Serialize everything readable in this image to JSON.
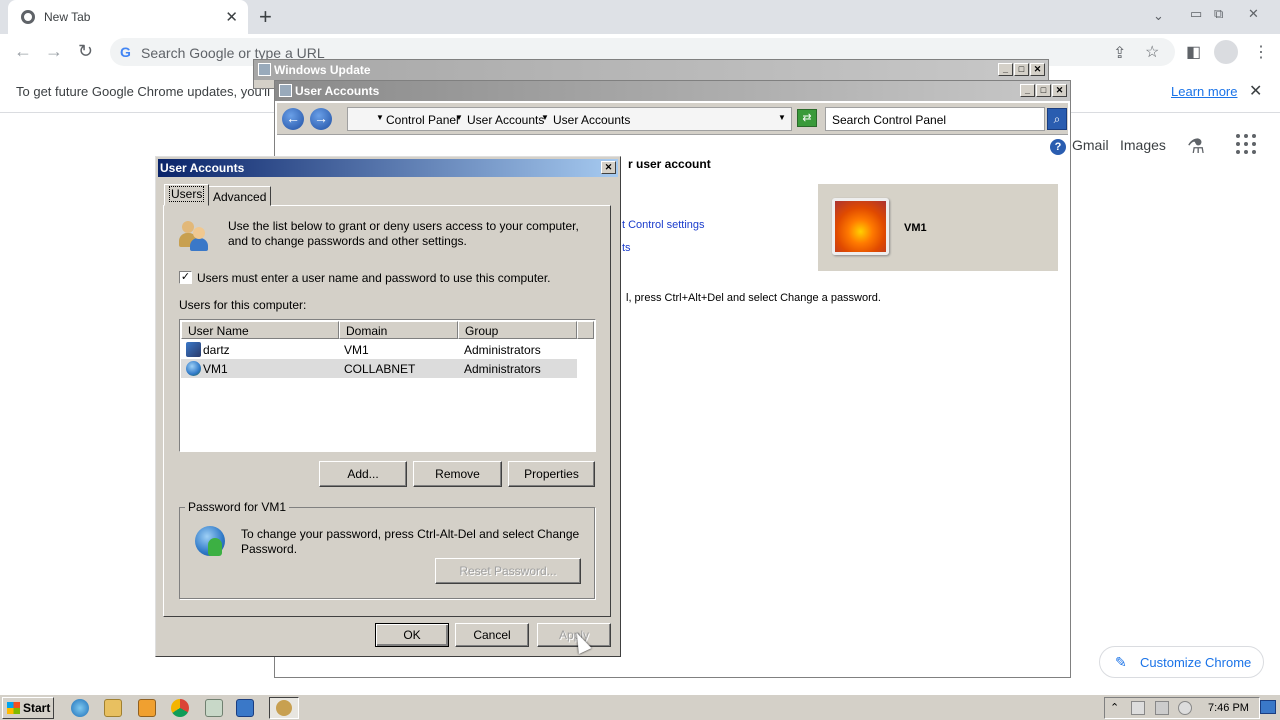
{
  "browser": {
    "tab_title": "New Tab",
    "omnibox_placeholder": "Search Google or type a URL",
    "infobar_text": "To get future Google Chrome updates, you'll",
    "learn_more": "Learn more",
    "ntp_links": [
      "Gmail",
      "Images"
    ],
    "customize_label": "Customize Chrome"
  },
  "windows_update": {
    "title": "Windows Update"
  },
  "user_accounts_window": {
    "title": "User Accounts",
    "breadcrumb": [
      "Control Panel",
      "User Accounts",
      "User Accounts"
    ],
    "search_placeholder": "Search Control Panel",
    "heading_fragment": "r user account",
    "link_fragment_1": "t Control settings",
    "link_fragment_2": "ts",
    "password_fragment": "l, press Ctrl+Alt+Del and select Change a password.",
    "user_tile_name": "VM1"
  },
  "dialog": {
    "title": "User Accounts",
    "tabs": [
      "Users",
      "Advanced"
    ],
    "intro_line1": "Use the list below to grant or deny users access to your computer,",
    "intro_line2": "and to change passwords and other settings.",
    "checkbox_label": "Users must enter a user name and password to use this computer.",
    "checkbox_checked": true,
    "users_label": "Users for this computer:",
    "columns": [
      "User Name",
      "Domain",
      "Group"
    ],
    "rows": [
      {
        "user": "dartz",
        "domain": "VM1",
        "group": "Administrators"
      },
      {
        "user": "VM1",
        "domain": "COLLABNET",
        "group": "Administrators"
      }
    ],
    "buttons": {
      "add": "Add...",
      "remove": "Remove",
      "properties": "Properties"
    },
    "password_group_label": "Password for VM1",
    "password_text_line1": "To change your password, press Ctrl-Alt-Del and select Change",
    "password_text_line2": "Password.",
    "reset_password": "Reset Password...",
    "ok": "OK",
    "cancel": "Cancel",
    "apply": "Apply"
  },
  "taskbar": {
    "start_label": "Start",
    "clock": "7:46 PM"
  },
  "colors": {
    "dialog_title_start": "#0a246a",
    "dialog_title_end": "#a6caf0",
    "chrome_blue": "#1a73e8"
  }
}
